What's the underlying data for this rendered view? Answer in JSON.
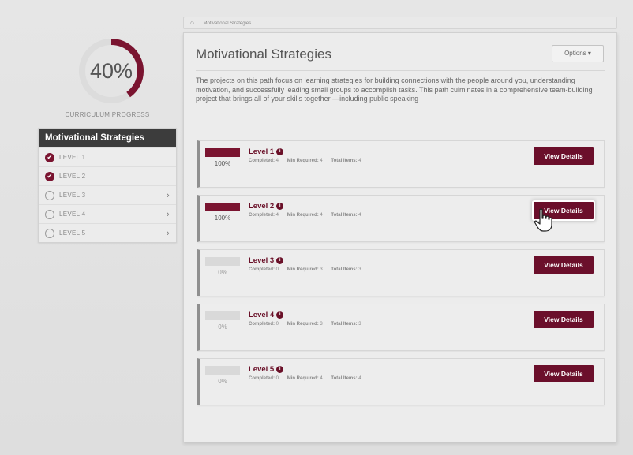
{
  "curriculum": {
    "percent_label": "40%",
    "percent": 40,
    "progress_label": "CURRICULUM PROGRESS",
    "accent_color": "#7a1430"
  },
  "breadcrumb": {
    "home_icon": "home-icon",
    "current": "Motivational Strategies"
  },
  "sidebar": {
    "heading": "Motivational Strategies",
    "items": [
      {
        "label": "LEVEL 1",
        "status": "complete",
        "icon": "check-circle-icon"
      },
      {
        "label": "LEVEL 2",
        "status": "complete",
        "icon": "check-circle-icon"
      },
      {
        "label": "LEVEL 3",
        "status": "incomplete",
        "icon": "empty-circle-icon"
      },
      {
        "label": "LEVEL 4",
        "status": "incomplete",
        "icon": "empty-circle-icon"
      },
      {
        "label": "LEVEL 5",
        "status": "incomplete",
        "icon": "empty-circle-icon"
      }
    ]
  },
  "main": {
    "title": "Motivational Strategies",
    "options_label": "Options",
    "description": "The projects on this path focus on learning strategies for building connections with the people around you, understanding motivation, and successfully leading small groups to accomplish tasks. This path culminates in a comprehensive team-building project that brings all of your skills together —including public speaking",
    "meta_labels": {
      "completed": "Completed:",
      "min_required": "Min Required:",
      "total_items": "Total Items:"
    },
    "view_label": "View Details",
    "levels": [
      {
        "title": "Level 1",
        "progress_label": "100%",
        "progress": 100,
        "completed": "4",
        "min_required": "4",
        "total_items": "4"
      },
      {
        "title": "Level 2",
        "progress_label": "100%",
        "progress": 100,
        "completed": "4",
        "min_required": "4",
        "total_items": "4"
      },
      {
        "title": "Level 3",
        "progress_label": "0%",
        "progress": 0,
        "completed": "0",
        "min_required": "3",
        "total_items": "3"
      },
      {
        "title": "Level 4",
        "progress_label": "0%",
        "progress": 0,
        "completed": "0",
        "min_required": "3",
        "total_items": "3"
      },
      {
        "title": "Level 5",
        "progress_label": "0%",
        "progress": 0,
        "completed": "0",
        "min_required": "4",
        "total_items": "4"
      }
    ]
  }
}
